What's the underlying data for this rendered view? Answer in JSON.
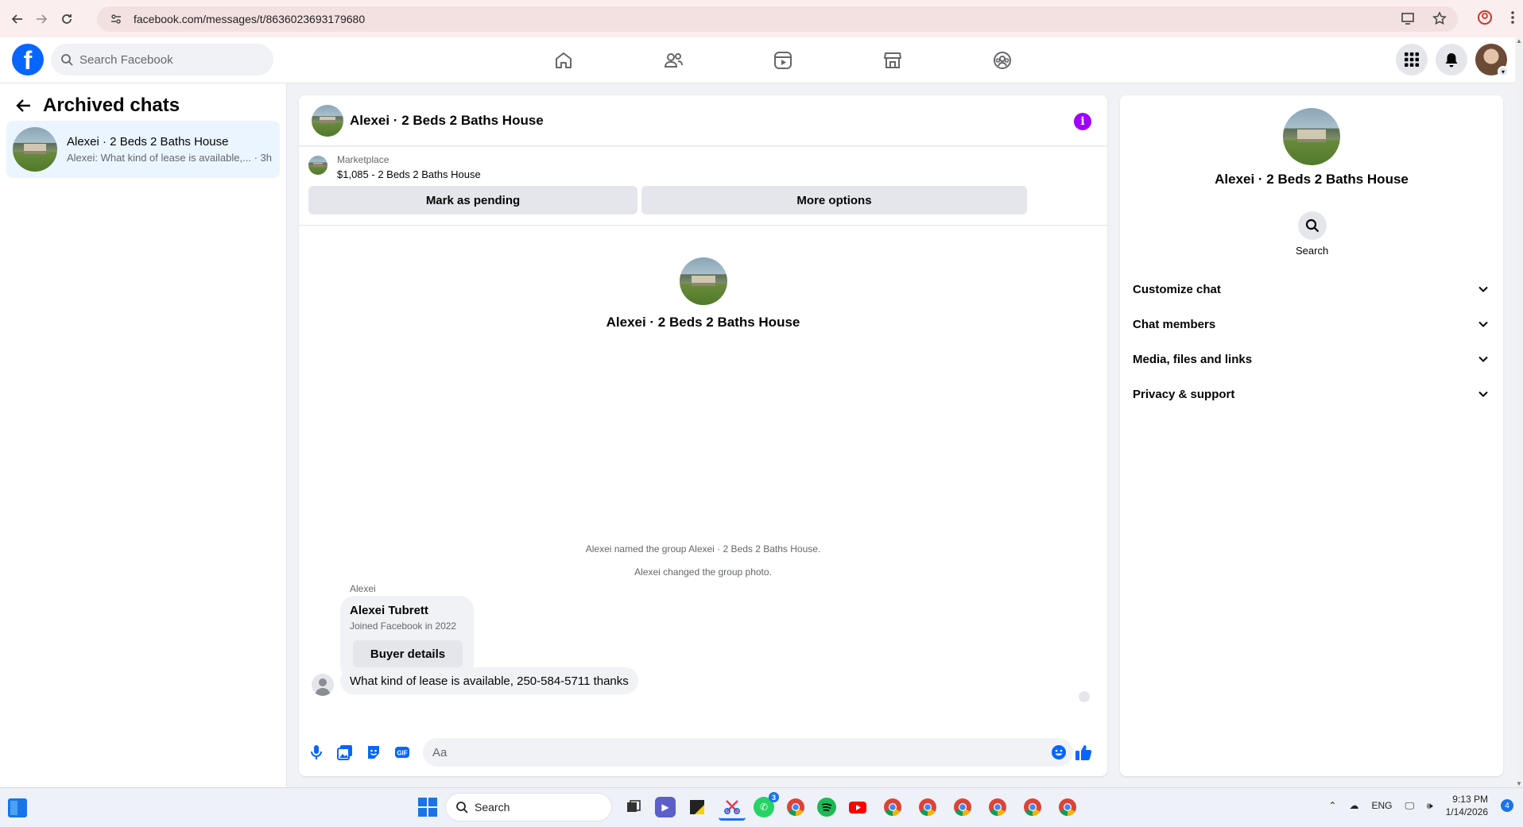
{
  "browser": {
    "url": "facebook.com/messages/t/8636023693179680"
  },
  "header": {
    "search_placeholder": "Search Facebook"
  },
  "sidebar": {
    "title": "Archived chats",
    "chats": [
      {
        "name": "Alexei · 2 Beds 2 Baths House",
        "preview": "Alexei: What kind of lease is available,...",
        "time": "· 3h"
      }
    ]
  },
  "conversation": {
    "title": "Alexei · 2 Beds 2 Baths House",
    "marketplace": {
      "label": "Marketplace",
      "listing": "$1,085 - 2 Beds 2 Baths House",
      "pending_button": "Mark as pending",
      "options_button": "More options"
    },
    "hero_name": "Alexei · 2 Beds 2 Baths House",
    "system_messages": [
      "Alexei named the group Alexei · 2 Beds 2 Baths House.",
      "Alexei changed the group photo."
    ],
    "sender": "Alexei",
    "buyer_card": {
      "name": "Alexei Tubrett",
      "joined": "Joined Facebook in 2022",
      "button": "Buyer details"
    },
    "message": "What kind of lease is available, 250-584-5711 thanks",
    "composer_placeholder": "Aa"
  },
  "details": {
    "name": "Alexei · 2 Beds 2 Baths House",
    "search_label": "Search",
    "sections": [
      "Customize chat",
      "Chat members",
      "Media, files and links",
      "Privacy & support"
    ]
  },
  "taskbar": {
    "search_placeholder": "Search",
    "whatsapp_badge": "3",
    "language": "ENG",
    "time": "9:13 PM",
    "date": "1/14/2026",
    "notification_count": "4"
  },
  "colors": {
    "brand": "#0866ff",
    "info": "#a100ff",
    "like": "#0866ff"
  }
}
